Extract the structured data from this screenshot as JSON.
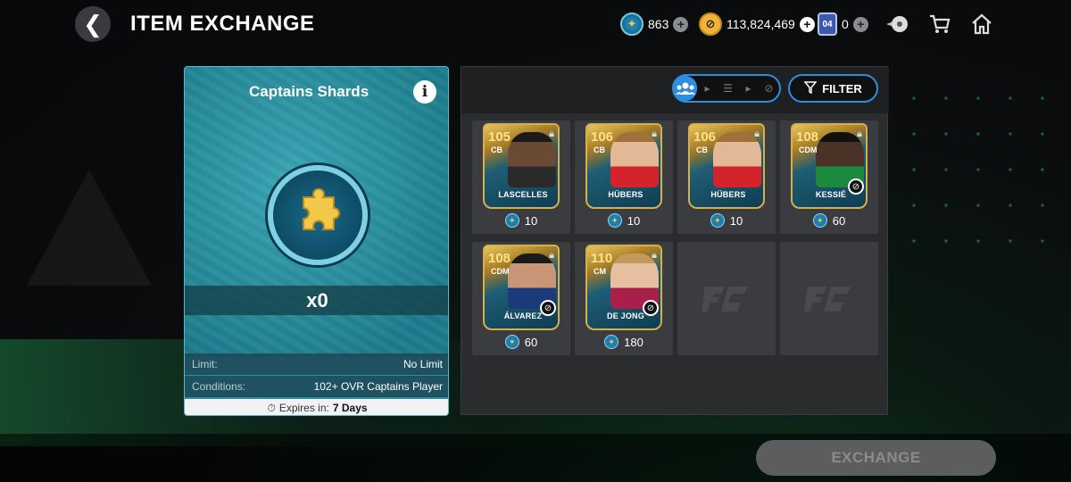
{
  "header": {
    "title": "ITEM EXCHANGE",
    "currencies": [
      {
        "name": "captains-shards",
        "icon": "puzzle-coin-icon",
        "value": "863"
      },
      {
        "name": "fc-points",
        "icon": "fc-points-icon",
        "value": "113,824,469"
      },
      {
        "name": "token",
        "icon": "token-card-icon",
        "badge": "04",
        "value": "0"
      }
    ]
  },
  "shard": {
    "title": "Captains Shards",
    "count": "x0",
    "limit_label": "Limit:",
    "limit_value": "No Limit",
    "conditions_label": "Conditions:",
    "conditions_value": "102+ OVR Captains Player",
    "expires_label": "Expires in:",
    "expires_value": "7 Days"
  },
  "panel": {
    "filter_label": "FILTER"
  },
  "players": [
    {
      "ovr": "105",
      "pos": "CB",
      "name": "LASCELLES",
      "cost": "10",
      "untradable": false,
      "skin": "#6b4a34",
      "hair": "#1a1a1a",
      "jersey": "#2a2a2a"
    },
    {
      "ovr": "106",
      "pos": "CB",
      "name": "HÜBERS",
      "cost": "10",
      "untradable": false,
      "skin": "#e3b896",
      "hair": "#a0703a",
      "jersey": "#d4232a"
    },
    {
      "ovr": "106",
      "pos": "CB",
      "name": "HÜBERS",
      "cost": "10",
      "untradable": false,
      "skin": "#e3b896",
      "hair": "#a0703a",
      "jersey": "#d4232a"
    },
    {
      "ovr": "108",
      "pos": "CDM",
      "name": "KESSIÉ",
      "cost": "60",
      "untradable": true,
      "skin": "#4a3226",
      "hair": "#111",
      "jersey": "#1c8a3e"
    },
    {
      "ovr": "108",
      "pos": "CDM",
      "name": "ÁLVAREZ",
      "cost": "60",
      "untradable": true,
      "skin": "#c99677",
      "hair": "#1a1a1a",
      "jersey": "#1b3a7a"
    },
    {
      "ovr": "110",
      "pos": "CM",
      "name": "DE JONG",
      "cost": "180",
      "untradable": true,
      "skin": "#e6bfa0",
      "hair": "#c49a5a",
      "jersey": "#a8204a"
    }
  ],
  "exchange_label": "EXCHANGE"
}
